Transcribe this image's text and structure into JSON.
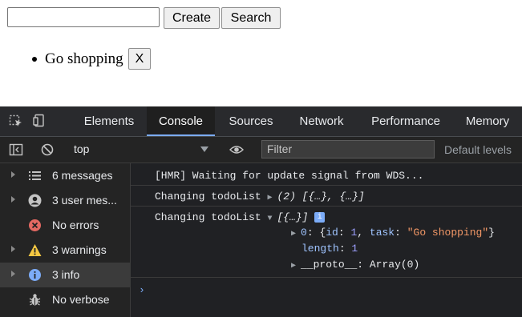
{
  "app": {
    "input": {
      "value": "",
      "placeholder": ""
    },
    "create_label": "Create",
    "search_label": "Search",
    "todos": [
      {
        "task": "Go shopping",
        "delete_label": "X"
      }
    ]
  },
  "devtools": {
    "tabs": [
      "Elements",
      "Console",
      "Sources",
      "Network",
      "Performance",
      "Memory"
    ],
    "active_tab": "Console",
    "filterbar": {
      "context": "top",
      "filter_placeholder": "Filter",
      "levels": "Default levels"
    },
    "sidebar": [
      {
        "label": "6 messages",
        "icon": "list-icon"
      },
      {
        "label": "3 user mes...",
        "icon": "user-icon"
      },
      {
        "label": "No errors",
        "icon": "error-icon"
      },
      {
        "label": "3 warnings",
        "icon": "warning-icon"
      },
      {
        "label": "3 info",
        "icon": "info-icon"
      },
      {
        "label": "No verbose",
        "icon": "bug-icon"
      }
    ],
    "console": {
      "line1": "[HMR] Waiting for update signal from WDS...",
      "line2_text": "Changing todoList",
      "line2_value": "(2) [{…}, {…}]",
      "line3_text": "Changing todoList",
      "line3_value": "[{…}]",
      "info_badge": "i",
      "obj_index": "0",
      "obj_id_key": "id",
      "obj_id_val": "1",
      "obj_task_key": "task",
      "obj_task_val": "\"Go shopping\"",
      "length_key": "length",
      "length_val": "1",
      "proto_key": "__proto__",
      "proto_val": "Array(0)",
      "prompt": "›"
    },
    "colors": {
      "background": "#242424",
      "active_tab_underline": "#7cacf8",
      "string": "#f29766",
      "error": "#e46962",
      "warning": "#f5c842",
      "info": "#7cacf8"
    }
  }
}
